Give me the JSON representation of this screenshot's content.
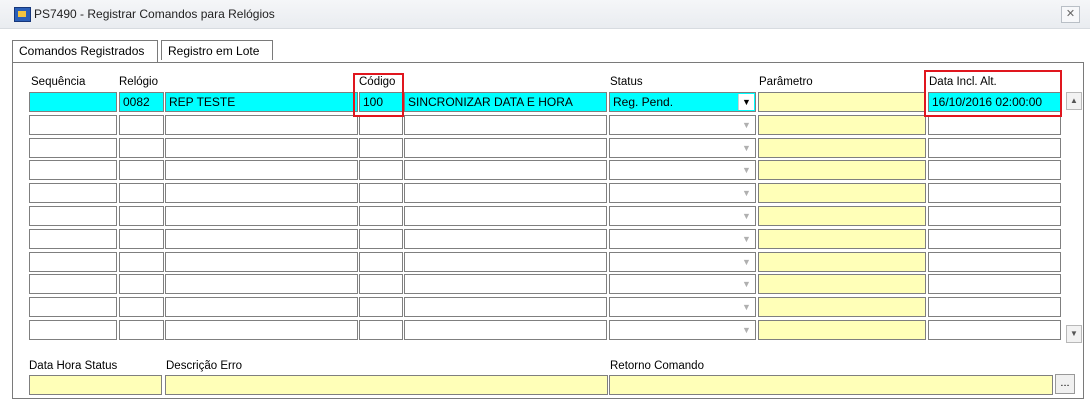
{
  "window": {
    "title": "PS7490 - Registrar Comandos para Relógios",
    "close_label": "✕"
  },
  "tabs": [
    {
      "label": "Comandos Registrados"
    },
    {
      "label": "Registro em Lote"
    }
  ],
  "columns": {
    "sequencia": "Sequência",
    "relogio": "Relógio",
    "codigo": "Código",
    "status": "Status",
    "parametro": "Parâmetro",
    "data_incl": "Data Incl. Alt."
  },
  "rows": [
    {
      "sequencia": "",
      "relogio_code": "0082",
      "relogio_name": "REP TESTE",
      "codigo": "100",
      "descricao": "SINCRONIZAR DATA E HORA",
      "status": "Reg. Pend.",
      "parametro": "",
      "data_incl": "16/10/2016 02:00:00"
    }
  ],
  "empty_row_count": 10,
  "footer": {
    "data_hora_status": "Data Hora Status",
    "descricao_erro": "Descrição Erro",
    "retorno_comando": "Retorno Comando",
    "dots_label": "..."
  },
  "icons": {
    "dropdown": "chevron-down-icon",
    "scroll_up": "scroll-up-icon",
    "scroll_down": "scroll-down-icon"
  },
  "colors": {
    "selected_row": "#00ffff",
    "param_field": "#ffffb8",
    "highlight": "#e0161e"
  }
}
